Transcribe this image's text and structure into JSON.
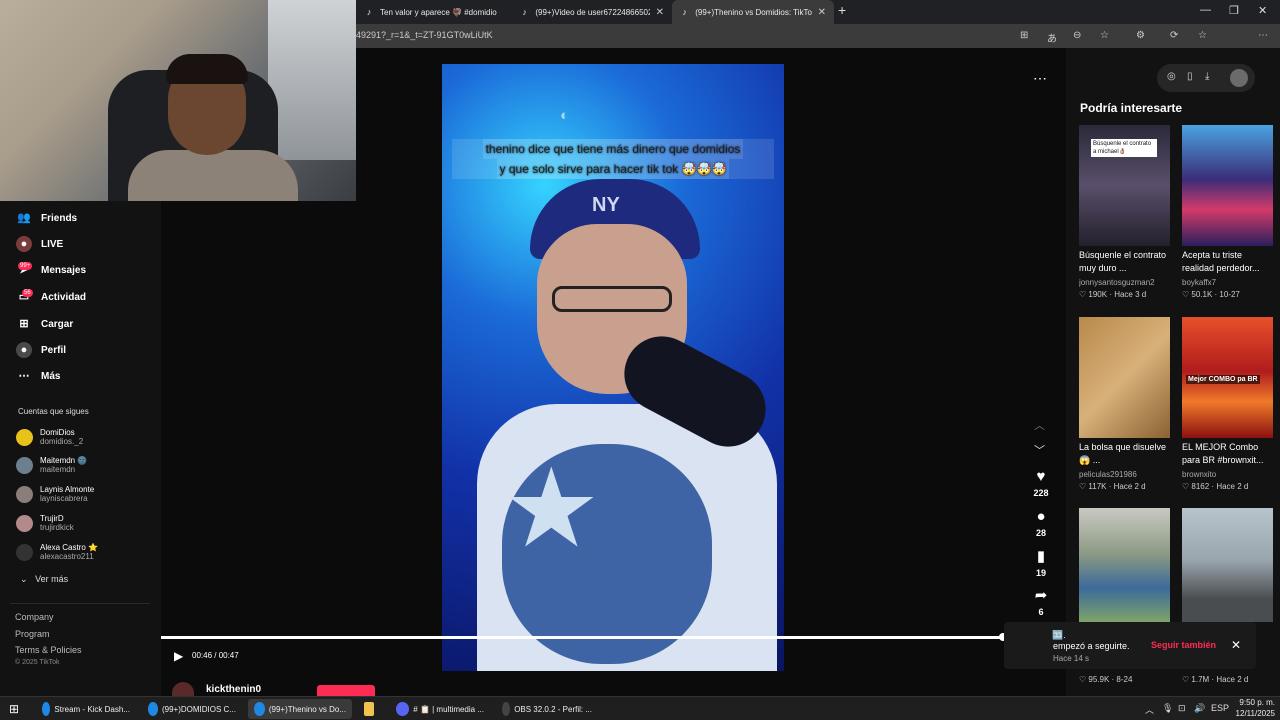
{
  "browser": {
    "tabs": [
      {
        "title": "Ten valor y aparece 🦃 #domidio",
        "icon": "tiktok-icon",
        "active": false
      },
      {
        "title": "(99+)Video de user67224866502 (",
        "icon": "tiktok-icon",
        "active": false
      },
      {
        "title": "(99+)Thenino vs Domidios: TikTok",
        "icon": "tiktok-icon",
        "active": true
      }
    ],
    "url": "49291?_r=1&_t=ZT-91GT0wLiUtK"
  },
  "nav": {
    "items": [
      {
        "label": "Friends",
        "icon": "friends-icon"
      },
      {
        "label": "LIVE",
        "icon": "live-icon"
      },
      {
        "label": "Mensajes",
        "icon": "messages-icon",
        "badge": "99+"
      },
      {
        "label": "Actividad",
        "icon": "activity-icon",
        "badge": "56"
      },
      {
        "label": "Cargar",
        "icon": "upload-icon"
      },
      {
        "label": "Perfil",
        "icon": "profile-icon"
      },
      {
        "label": "Más",
        "icon": "more-icon"
      }
    ],
    "following_title": "Cuentas que sigues",
    "following": [
      {
        "name": "DomiDios",
        "handle": "domidios._2",
        "color": "#e6c21a"
      },
      {
        "name": "Maitemdn 🌚",
        "handle": "maitemdn",
        "color": "#6c7f8f"
      },
      {
        "name": "Laynis Almonte",
        "handle": "layniscabrera",
        "color": "#8a7d7a"
      },
      {
        "name": "TrujirD",
        "handle": "trujirdkick",
        "color": "#b28a8a"
      },
      {
        "name": "Alexa Castro ⭐",
        "handle": "alexacastro211",
        "color": "#333333"
      }
    ],
    "see_more": "Ver más",
    "footer": [
      "Company",
      "Program",
      "Terms & Policies"
    ],
    "copyright": "© 2025 TikTok"
  },
  "video": {
    "caption_line1": "thenino dice que tiene más dinero que domidios",
    "caption_line2": "y que solo sirve para hacer tik tok 🤯🤯🤯",
    "hat_logo": "NY",
    "time": "00:46 / 00:47",
    "progress_fraction": 0.98,
    "author": "kickthenin0"
  },
  "actions": [
    {
      "icon": "heart-icon",
      "glyph": "♥",
      "count": "228"
    },
    {
      "icon": "comment-icon",
      "glyph": "💬",
      "count": "28"
    },
    {
      "icon": "bookmark-icon",
      "glyph": "🔖",
      "count": "19"
    },
    {
      "icon": "share-icon",
      "glyph": "➦",
      "count": "6"
    }
  ],
  "recommended": {
    "title": "Podría interesarte",
    "cards": [
      {
        "title": "Búsquenle el contrato muy duro ...",
        "user": "jonnysantosguzman2",
        "likes": "190K",
        "date": "Hace 3 d",
        "thumb_caption": "Búsquenle el contrato a michael👌🏽",
        "bg": "linear-gradient(180deg,#2a2a3a,#5a4f6b 50%,#23202c)"
      },
      {
        "title": "Acepta tu triste realidad perdedor...",
        "user": "boykaffx7",
        "likes": "50.1K",
        "date": "10-27",
        "bg": "linear-gradient(180deg,#4aa3e0,#3b2d78 45%,#d43a6a 70%,#2a1f5c)"
      },
      {
        "title": "La bolsa que disuelve😱 ...",
        "user": "peliculas291986",
        "likes": "117K",
        "date": "Hace 2 d",
        "bg": "linear-gradient(135deg,#b88a4a,#d8b07a 50%,#8a6232)"
      },
      {
        "title": "EL MEJOR Combo para BR #brownxit...",
        "user": "brownxito",
        "likes": "8162",
        "date": "Hace 2 d",
        "thumb_caption": "Mejor COMBO pa BR",
        "bg": "linear-gradient(180deg,#e8502a,#b01c1c 45%,#f07a2a 70%,#8a1010)"
      },
      {
        "title": "",
        "user": "",
        "likes": "95.9K",
        "date": "8-24",
        "bg": "linear-gradient(180deg,#c9c9c2,#8d9a84 40%,#3c6a9a 70%,#7fa36a)"
      },
      {
        "title": "",
        "user": "",
        "likes": "1.7M",
        "date": "Hace 2 d",
        "bg": "linear-gradient(180deg,#b8c4cc,#9aa6ae 45%,#4a4d50 80%)"
      }
    ]
  },
  "notification": {
    "icon_text": "🈁.",
    "text": "empezó a seguirte.",
    "button": "Seguir también",
    "time": "Hace 14 s"
  },
  "taskbar": {
    "items": [
      {
        "label": "Stream - Kick Dash...",
        "icon": "edge-icon",
        "color": "#1e88e5",
        "active": false
      },
      {
        "label": "(99+)DOMIDIOS C...",
        "icon": "edge-icon",
        "color": "#1e88e5",
        "active": false
      },
      {
        "label": "(99+)Thenino vs Do...",
        "icon": "edge-icon",
        "color": "#1e88e5",
        "active": true
      },
      {
        "label": "",
        "icon": "folder-icon",
        "color": "#f2c14e",
        "active": false
      },
      {
        "label": "# 📋 | multimedia ...",
        "icon": "discord-icon",
        "color": "#5865f2",
        "active": false
      },
      {
        "label": "OBS 32.0.2 - Perfil: ...",
        "icon": "obs-icon",
        "color": "#444",
        "active": false
      }
    ],
    "lang": "ESP",
    "time": "9:50 p. m.",
    "date": "12/11/2025"
  }
}
